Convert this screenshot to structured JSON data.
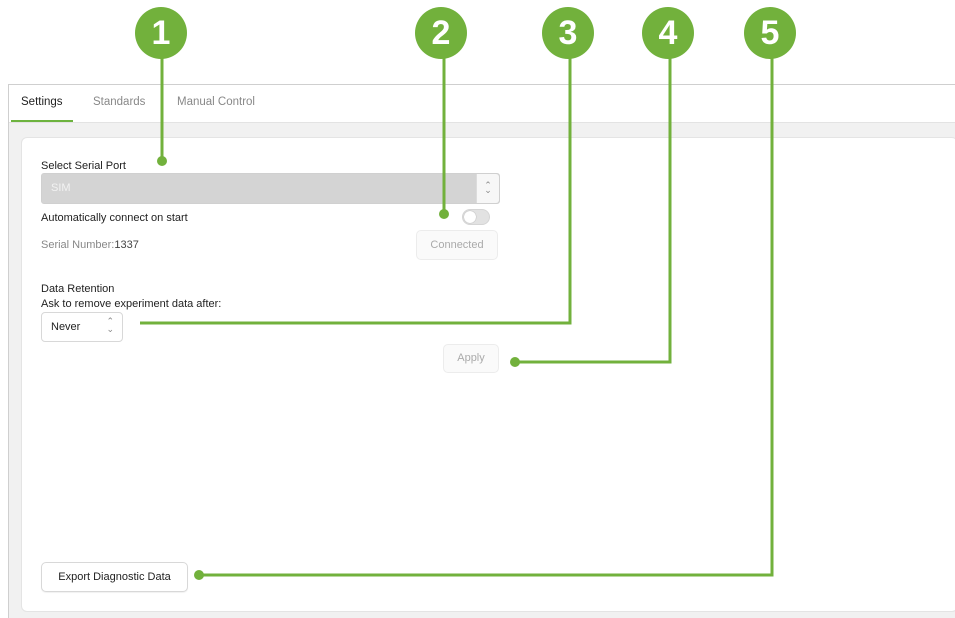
{
  "tabs": [
    {
      "label": "Settings",
      "active": true
    },
    {
      "label": "Standards",
      "active": false
    },
    {
      "label": "Manual Control",
      "active": false
    }
  ],
  "serial": {
    "heading": "Select Serial Port",
    "selected_port": "SIM",
    "auto_connect_label": "Automatically connect on start",
    "auto_connect_enabled": false,
    "serial_number_label": "Serial Number:",
    "serial_number_value": "1337",
    "connect_button": "Connected"
  },
  "retention": {
    "heading": "Data Retention",
    "prompt": "Ask to remove experiment data after:",
    "selected": "Never",
    "apply_button": "Apply"
  },
  "export_button": "Export Diagnostic Data",
  "callouts": [
    "1",
    "2",
    "3",
    "4",
    "5"
  ],
  "colors": {
    "callout": "#72b13c",
    "tab_accent": "#6db33f",
    "disabled_select": "#d4d4d4"
  }
}
